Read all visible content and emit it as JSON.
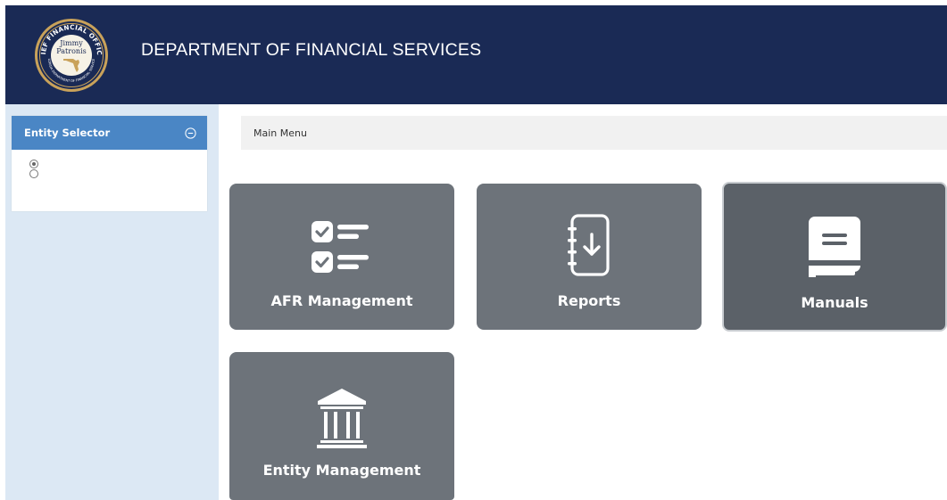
{
  "header": {
    "title": "DEPARTMENT OF FINANCIAL SERVICES",
    "seal": {
      "top_text": "CHIEF FINANCIAL OFFICER",
      "name_line1": "Jimmy",
      "name_line2": "Patronis",
      "bottom_text": "FLORIDA DEPARTMENT OF FINANCIAL SERVICES"
    },
    "background_color": "#1a2a55"
  },
  "sidebar": {
    "panel_title": "Entity Selector",
    "collapse_icon": "minus-circle-icon",
    "radio_options": [
      {
        "label": "",
        "checked": true
      },
      {
        "label": "",
        "checked": false
      }
    ],
    "header_color": "#4a86c5"
  },
  "breadcrumb": {
    "label": "Main Menu"
  },
  "tiles": [
    {
      "label": "AFR Management",
      "icon": "checklist-icon"
    },
    {
      "label": "Reports",
      "icon": "report-download-icon"
    },
    {
      "label": "Manuals",
      "icon": "book-icon"
    },
    {
      "label": "Entity Management",
      "icon": "bank-building-icon"
    }
  ],
  "colors": {
    "tile": "#6d737a",
    "tile_active": "#5b6168",
    "sidebar_bg": "#dce8f4"
  }
}
